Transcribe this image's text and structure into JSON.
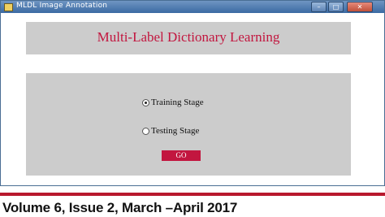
{
  "window": {
    "title": "MLDL Image Annotation",
    "controls": {
      "minimize": "–",
      "maximize": "□",
      "close": "✕"
    }
  },
  "header": {
    "title": "Multi-Label Dictionary Learning",
    "title_color": "#c2163f"
  },
  "stages": {
    "options": [
      {
        "label": "Training Stage",
        "selected": true
      },
      {
        "label": "Testing Stage",
        "selected": false
      }
    ]
  },
  "go_button": {
    "label": "GO",
    "color": "#c2163f"
  },
  "footer": {
    "text": "Volume 6, Issue 2, March –April 2017",
    "rule_color": "#b8182d"
  }
}
